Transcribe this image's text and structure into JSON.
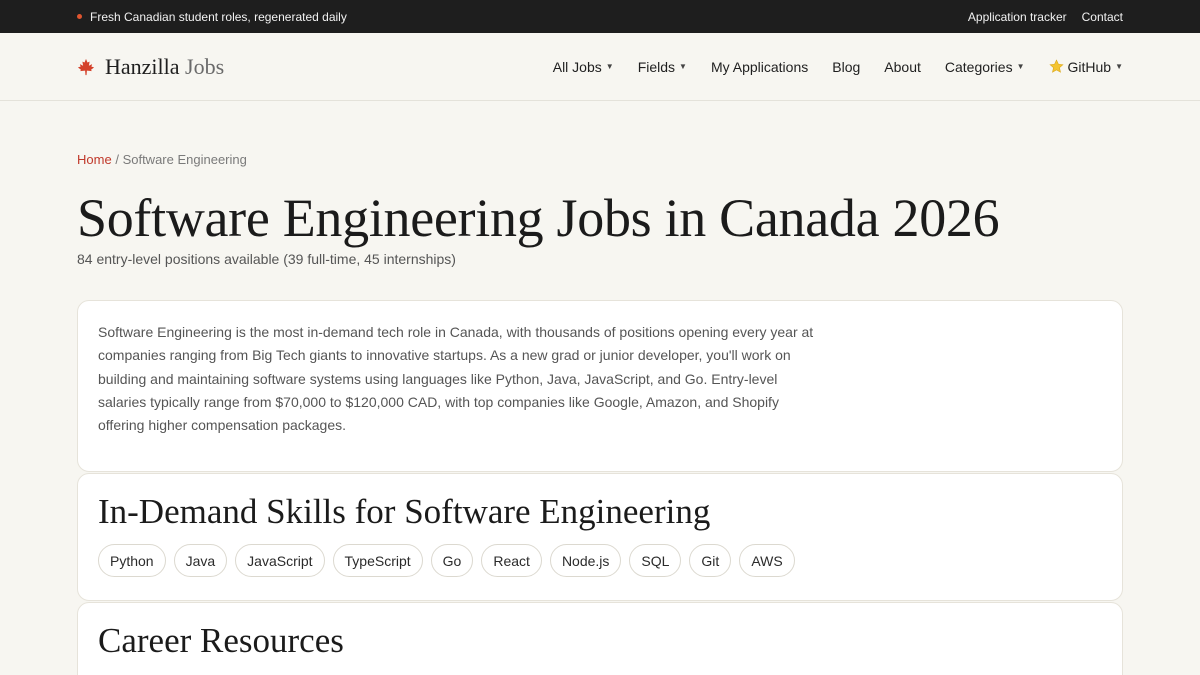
{
  "topbar": {
    "announcement": "Fresh Canadian student roles, regenerated daily",
    "links": [
      "Application tracker",
      "Contact"
    ]
  },
  "brand": {
    "name_bold": "Hanzilla",
    "name_light": "Jobs",
    "logo_icon": "maple-leaf-icon"
  },
  "nav": {
    "items": [
      {
        "label": "All Jobs",
        "dropdown": true
      },
      {
        "label": "Fields",
        "dropdown": true
      },
      {
        "label": "My Applications",
        "dropdown": false
      },
      {
        "label": "Blog",
        "dropdown": false
      },
      {
        "label": "About",
        "dropdown": false
      },
      {
        "label": "Categories",
        "dropdown": true
      },
      {
        "label": "GitHub",
        "dropdown": true,
        "icon": "star-icon"
      }
    ]
  },
  "breadcrumb": {
    "home": "Home",
    "separator": "/",
    "current": "Software Engineering"
  },
  "page": {
    "title": "Software Engineering Jobs in Canada 2026",
    "subtitle": "84 entry-level positions available (39 full-time, 45 internships)"
  },
  "intro": {
    "text": "Software Engineering is the most in-demand tech role in Canada, with thousands of positions opening every year at companies ranging from Big Tech giants to innovative startups. As a new grad or junior developer, you'll work on building and maintaining software systems using languages like Python, Java, JavaScript, and Go. Entry-level salaries typically range from $70,000 to $120,000 CAD, with top companies like Google, Amazon, and Shopify offering higher compensation packages."
  },
  "skills": {
    "heading": "In-Demand Skills for Software Engineering",
    "items": [
      "Python",
      "Java",
      "JavaScript",
      "TypeScript",
      "Go",
      "React",
      "Node.js",
      "SQL",
      "Git",
      "AWS"
    ]
  },
  "resources": {
    "heading": "Career Resources"
  },
  "colors": {
    "accent": "#c0392b",
    "topbar_bg": "#1e1e1e",
    "page_bg": "#f7f6f1"
  }
}
